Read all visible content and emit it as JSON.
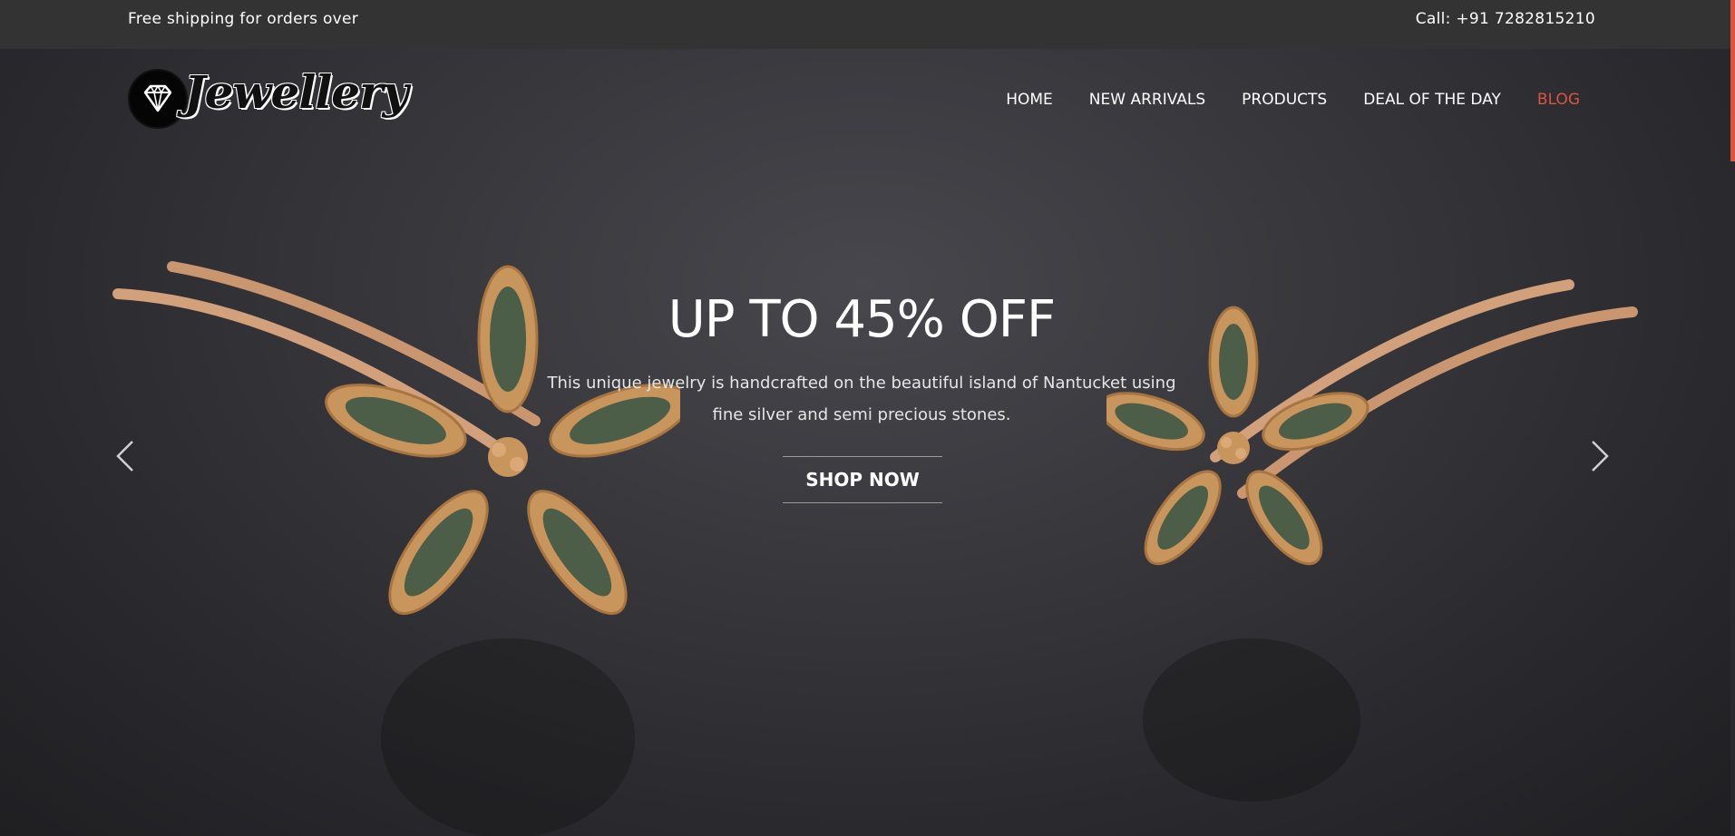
{
  "topbar": {
    "shipping_text": "Free shipping for orders over",
    "phone_text": "Call: +91 7282815210"
  },
  "logo": {
    "text": "Jewellery",
    "icon": "diamond-icon"
  },
  "nav": {
    "items": [
      {
        "label": "HOME"
      },
      {
        "label": "NEW ARRIVALS"
      },
      {
        "label": "PRODUCTS"
      },
      {
        "label": "DEAL OF THE DAY"
      },
      {
        "label": "BLOG"
      }
    ],
    "active_color": "#d9553f"
  },
  "hero": {
    "title": "UP TO 45% OFF",
    "description": "This unique jewelry is handcrafted on the beautiful island of Nantucket using fine silver and semi precious stones.",
    "cta_label": "SHOP NOW",
    "prev_icon": "chevron-left-icon",
    "next_icon": "chevron-right-icon"
  },
  "colors": {
    "accent": "#d9553f",
    "topbar_bg": "#333334"
  }
}
